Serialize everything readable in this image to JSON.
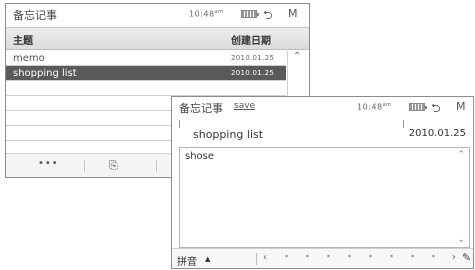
{
  "back_window": {
    "status": {
      "app_title": "备忘记事",
      "time": "10:48",
      "ampm": "am",
      "back_glyph": "⮌",
      "menu_glyph": "M"
    },
    "list_header": {
      "col_title": "主题",
      "col_date": "创建日期"
    },
    "rows": [
      {
        "name": "memo",
        "date": "2010.01.25"
      },
      {
        "name": "shopping list",
        "date": "2010.01.25"
      },
      {
        "name": "",
        "date": ""
      },
      {
        "name": "",
        "date": ""
      },
      {
        "name": "",
        "date": ""
      },
      {
        "name": "",
        "date": ""
      }
    ],
    "selected_row": 1,
    "scroll_up_glyph": "⌃",
    "toolbar": {
      "more_label": "•••",
      "export_glyph": "⎘"
    }
  },
  "front_window": {
    "status": {
      "app_title": "备忘记事",
      "save_label": "save",
      "time": "10:48",
      "ampm": "am",
      "back_glyph": "⮌",
      "menu_glyph": "M"
    },
    "note": {
      "title": "shopping list",
      "date": "2010.01.25"
    },
    "editor": {
      "content": "shose",
      "scroll_up_glyph": "⌃",
      "scroll_down_glyph": "⌄"
    },
    "keyboard_bar": {
      "ime_label": "拼音",
      "ime_arrow": "▲",
      "cursor_left": "‹",
      "cursor_right": "›",
      "edit_glyph": "✎"
    }
  }
}
